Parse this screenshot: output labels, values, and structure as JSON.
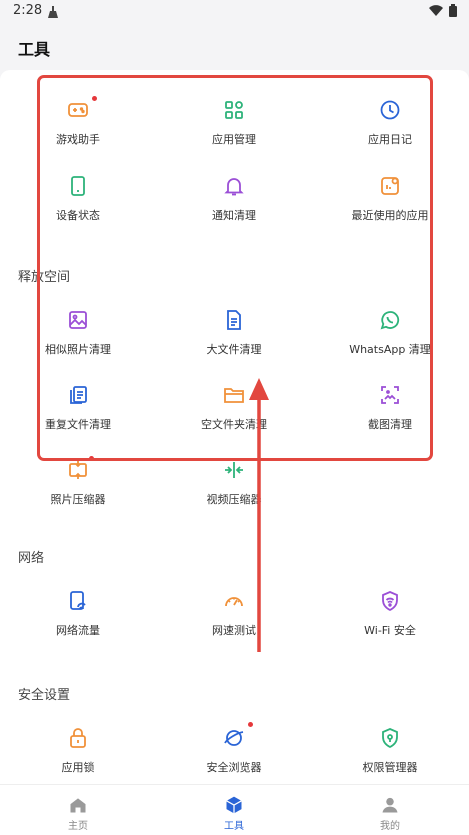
{
  "status_bar": {
    "time": "2:28"
  },
  "header": {
    "title": "工具"
  },
  "sections": {
    "top": {
      "items": [
        {
          "label": "游戏助手",
          "icon": "gamepad-icon",
          "color": "#f0913a",
          "badge": true
        },
        {
          "label": "应用管理",
          "icon": "apps-grid-icon",
          "color": "#2db37a",
          "badge": false
        },
        {
          "label": "应用日记",
          "icon": "clock-icon",
          "color": "#2a64d6",
          "badge": false
        },
        {
          "label": "设备状态",
          "icon": "phone-icon",
          "color": "#2db37a",
          "badge": false
        },
        {
          "label": "通知清理",
          "icon": "bell-icon",
          "color": "#9b4fd6",
          "badge": false
        },
        {
          "label": "最近使用的应用",
          "icon": "recent-app-icon",
          "color": "#f0913a",
          "badge": false
        }
      ]
    },
    "free_space": {
      "title": "释放空间",
      "items": [
        {
          "label": "相似照片清理",
          "icon": "image-icon",
          "color": "#9b4fd6"
        },
        {
          "label": "大文件清理",
          "icon": "document-icon",
          "color": "#2a64d6"
        },
        {
          "label": "WhatsApp 清理",
          "icon": "whatsapp-icon",
          "color": "#2db37a"
        },
        {
          "label": "重复文件清理",
          "icon": "duplicate-file-icon",
          "color": "#2a64d6"
        },
        {
          "label": "空文件夹清理",
          "icon": "folder-icon",
          "color": "#f0913a"
        },
        {
          "label": "截图清理",
          "icon": "screenshot-icon",
          "color": "#9b4fd6"
        },
        {
          "label": "照片压缩器",
          "icon": "photo-compress-icon",
          "color": "#f0913a"
        },
        {
          "label": "视频压缩器",
          "icon": "video-compress-icon",
          "color": "#2db37a"
        }
      ]
    },
    "network": {
      "title": "网络",
      "items": [
        {
          "label": "网络流量",
          "icon": "data-usage-icon",
          "color": "#2a64d6"
        },
        {
          "label": "网速测试",
          "icon": "speedometer-icon",
          "color": "#f0913a"
        },
        {
          "label": "Wi-Fi 安全",
          "icon": "wifi-shield-icon",
          "color": "#9b4fd6"
        }
      ]
    },
    "security": {
      "title": "安全设置",
      "items": [
        {
          "label": "应用锁",
          "icon": "lock-icon",
          "color": "#f0913a",
          "badge": false
        },
        {
          "label": "安全浏览器",
          "icon": "browser-icon",
          "color": "#2a64d6",
          "badge": true
        },
        {
          "label": "权限管理器",
          "icon": "shield-lock-icon",
          "color": "#2db37a",
          "badge": false
        }
      ]
    }
  },
  "bottom_nav": {
    "items": [
      {
        "label": "主页",
        "icon": "home-icon",
        "active": false
      },
      {
        "label": "工具",
        "icon": "toolbox-icon",
        "active": true
      },
      {
        "label": "我的",
        "icon": "profile-icon",
        "active": false
      }
    ]
  },
  "colors": {
    "accent": "#2a64d6",
    "highlight": "#e2473f",
    "badge": "#e5383b"
  }
}
